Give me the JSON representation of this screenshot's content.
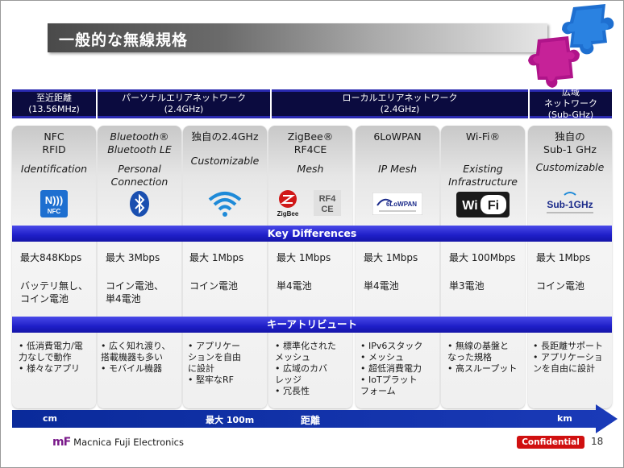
{
  "title": "一般的な無線規格",
  "ranges": [
    {
      "lines": [
        "至近距離",
        "(13.56MHz)"
      ]
    },
    {
      "lines": [
        "パーソナルエリアネットワーク",
        "(2.4GHz)"
      ]
    },
    {
      "lines": [
        "ローカルエリアネットワーク",
        "(2.4GHz)"
      ]
    },
    {
      "lines": [
        "広域",
        "ネットワーク",
        "(Sub-GHz)"
      ]
    }
  ],
  "columns": [
    {
      "head": [
        "NFC",
        "RFID"
      ],
      "sub": [
        "Identification"
      ],
      "logo": "NFC"
    },
    {
      "head": [
        "Bluetooth®",
        "Bluetooth LE"
      ],
      "sub": [
        "Personal",
        "Connection"
      ],
      "logo": ""
    },
    {
      "head": [
        "独自の2.4GHz"
      ],
      "sub": [
        "Customizable"
      ],
      "logo": ""
    },
    {
      "head": [
        "ZigBee®",
        "RF4CE"
      ],
      "sub": [
        "Mesh"
      ],
      "logo": "ZigBee"
    },
    {
      "head": [
        "6LoWPAN"
      ],
      "sub": [
        "IP Mesh"
      ],
      "logo": "6LoWPAN"
    },
    {
      "head": [
        "Wi-Fi®"
      ],
      "sub": [
        "Existing",
        "Infrastructure"
      ],
      "logo": "WiFi"
    },
    {
      "head": [
        "独自の",
        "Sub-1 GHz"
      ],
      "sub": [
        "Customizable"
      ],
      "logo": "Sub-1GHz"
    }
  ],
  "key_differences_label": "Key Differences",
  "speeds": [
    "最大848Kbps",
    "最大 3Mbps",
    "最大 1Mbps",
    "最大 1Mbps",
    "最大 1Mbps",
    "最大 100Mbps",
    "最大 1Mbps"
  ],
  "power": [
    [
      "バッテリ無し、",
      "コイン電池"
    ],
    [
      "コイン電池、",
      "単4電池"
    ],
    [
      "コイン電池"
    ],
    [
      "単4電池"
    ],
    [
      "単4電池"
    ],
    [
      "単3電池"
    ],
    [
      "コイン電池"
    ]
  ],
  "key_attributes_label": "キーアトリビュート",
  "attributes": [
    [
      [
        "• 低消費電力/電",
        "  力なしで動作"
      ],
      [
        "• 様々なアプリ"
      ]
    ],
    [
      [
        "• 広く知れ渡り、",
        "  搭載機器も多い"
      ],
      [
        "• モバイル機器"
      ]
    ],
    [
      [
        "• アプリケー",
        "  ションを自由",
        "  に設計"
      ],
      [
        "• 堅牢なRF"
      ]
    ],
    [
      [
        "• 標準化された",
        "  メッシュ"
      ],
      [
        "• 広域のカバ",
        "  レッジ"
      ],
      [
        "• 冗長性"
      ]
    ],
    [
      [
        "• IPv6スタック"
      ],
      [
        "• メッシュ"
      ],
      [
        "• 超低消費電力"
      ],
      [
        "• IoTプラット",
        "  フォーム"
      ]
    ],
    [
      [
        "• 無線の基盤と",
        "  なった規格"
      ],
      [
        "• 高スループット"
      ]
    ],
    [
      [
        "• 長距離サポート"
      ],
      [
        "• アプリケーショ",
        "  ンを自由に設計"
      ]
    ]
  ],
  "axis": {
    "left": "cm",
    "mid": "最大 100m",
    "center": "距離",
    "right": "km"
  },
  "footer": {
    "logo_mark": "mF",
    "company": "Macnica Fuji Electronics",
    "confidential": "Confidential",
    "page": "18"
  },
  "colors": {
    "band": "#1f1fc8",
    "range_bg": "#0b0b3f",
    "confidential": "#d01010",
    "brand": "#7a1a8a"
  }
}
